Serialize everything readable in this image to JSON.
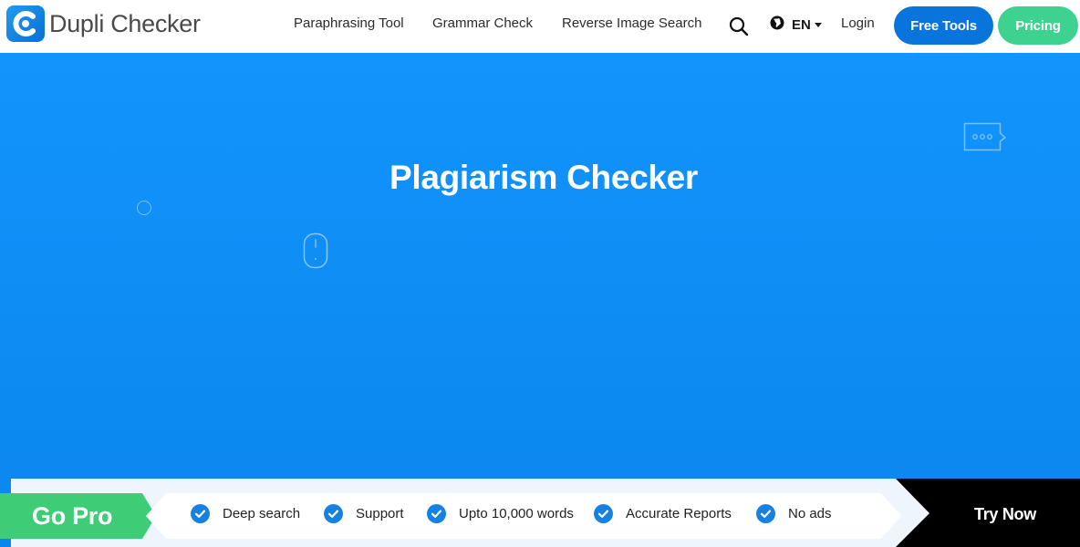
{
  "brand": {
    "name": "Dupli Checker",
    "logo_icon": "c-logo-icon",
    "color_primary": "#0a74dd",
    "color_accent": "#3ed291"
  },
  "nav": {
    "links": [
      "Paraphrasing Tool",
      "Grammar Check",
      "Reverse Image Search"
    ],
    "search_icon": "search-icon",
    "language": {
      "icon": "globe-icon",
      "code": "EN"
    },
    "login": "Login",
    "free_tools": "Free Tools",
    "pricing": "Pricing"
  },
  "hero": {
    "title": "Plagiarism Checker",
    "background": "#1294fc"
  },
  "promo": {
    "badge": "Go Pro",
    "features": [
      "Deep search",
      "Support",
      "Upto 10,000 words",
      "Accurate Reports",
      "No ads"
    ],
    "cta": "Try Now",
    "badge_color": "#3ecc77",
    "check_color": "#1581e2"
  }
}
